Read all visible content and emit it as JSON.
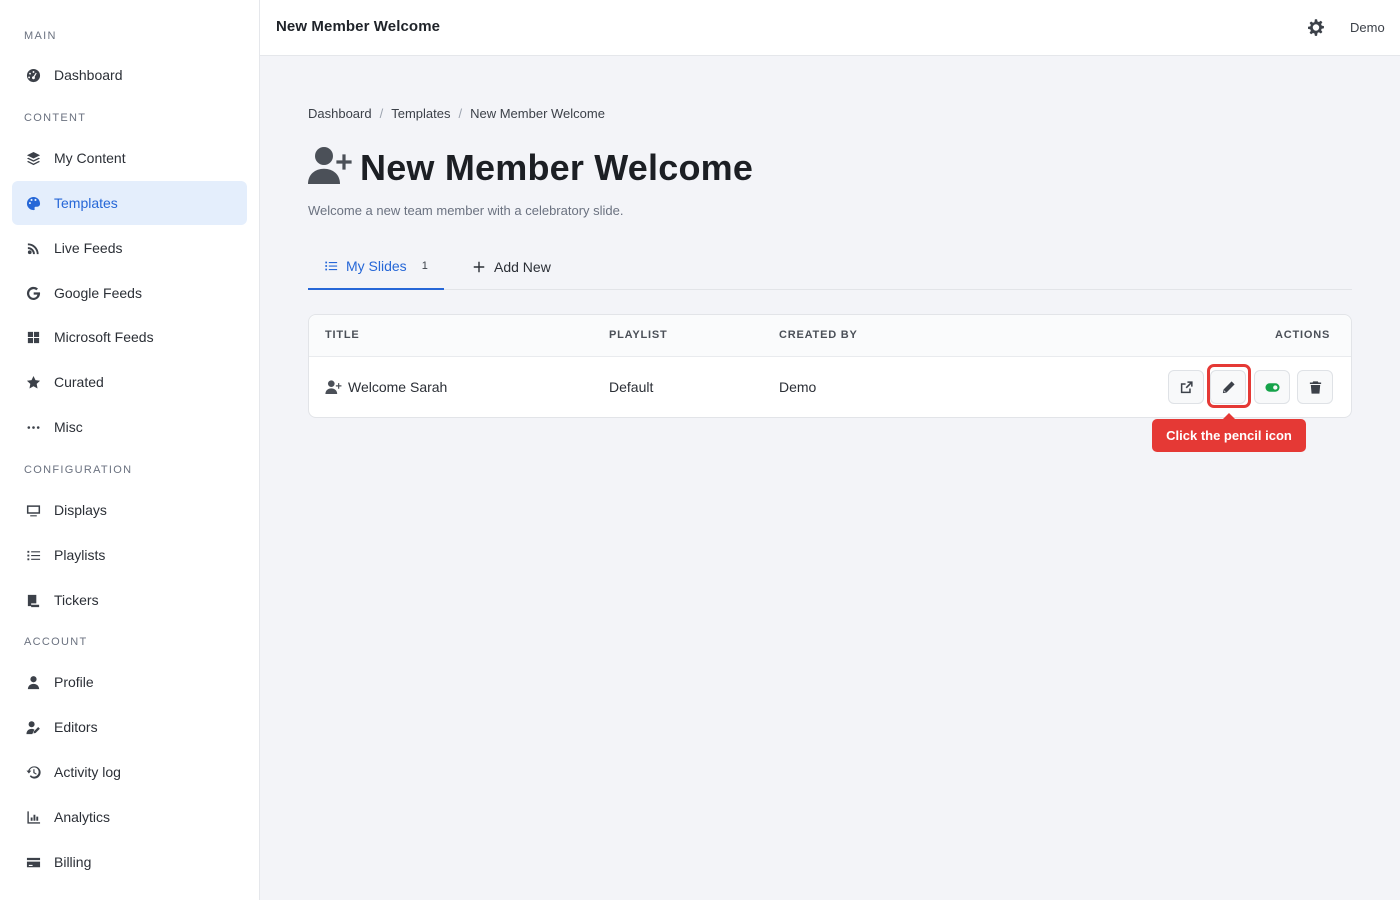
{
  "header": {
    "title": "New Member Welcome",
    "user": "Demo"
  },
  "sidebar": {
    "sections": [
      {
        "label": "MAIN",
        "items": [
          {
            "label": "Dashboard",
            "icon": "dashboard-icon"
          }
        ]
      },
      {
        "label": "CONTENT",
        "items": [
          {
            "label": "My Content",
            "icon": "layers-icon"
          },
          {
            "label": "Templates",
            "icon": "palette-icon",
            "active": true
          },
          {
            "label": "Live Feeds",
            "icon": "feed-icon"
          },
          {
            "label": "Google Feeds",
            "icon": "google-icon"
          },
          {
            "label": "Microsoft Feeds",
            "icon": "windows-icon"
          },
          {
            "label": "Curated",
            "icon": "star-icon"
          },
          {
            "label": "Misc",
            "icon": "ellipsis-icon"
          }
        ]
      },
      {
        "label": "CONFIGURATION",
        "items": [
          {
            "label": "Displays",
            "icon": "monitor-icon"
          },
          {
            "label": "Playlists",
            "icon": "list-icon"
          },
          {
            "label": "Tickers",
            "icon": "scroll-icon"
          }
        ]
      },
      {
        "label": "ACCOUNT",
        "items": [
          {
            "label": "Profile",
            "icon": "user-icon"
          },
          {
            "label": "Editors",
            "icon": "user-edit-icon"
          },
          {
            "label": "Activity log",
            "icon": "history-icon"
          },
          {
            "label": "Analytics",
            "icon": "chart-icon"
          },
          {
            "label": "Billing",
            "icon": "credit-card-icon"
          }
        ]
      }
    ]
  },
  "breadcrumb": [
    "Dashboard",
    "Templates",
    "New Member Welcome"
  ],
  "page": {
    "title": "New Member Welcome",
    "subtitle": "Welcome a new team member with a celebratory slide.",
    "title_icon": "user-plus-icon"
  },
  "tabs": [
    {
      "label": "My Slides",
      "count": "1",
      "active": true,
      "icon": "list-icon"
    },
    {
      "label": "Add New",
      "icon": "plus-icon"
    }
  ],
  "table": {
    "columns": [
      "TITLE",
      "PLAYLIST",
      "CREATED BY",
      "ACTIONS"
    ],
    "rows": [
      {
        "title": "Welcome Sarah",
        "playlist": "Default",
        "created_by": "Demo"
      }
    ],
    "actions": [
      "external-link-icon",
      "pencil-icon",
      "toggle-icon",
      "trash-icon"
    ]
  },
  "tooltip": {
    "text": "Click the pencil icon"
  },
  "colors": {
    "accent": "#2667d7",
    "highlight": "#e53935",
    "toggle": "#16a34a"
  }
}
